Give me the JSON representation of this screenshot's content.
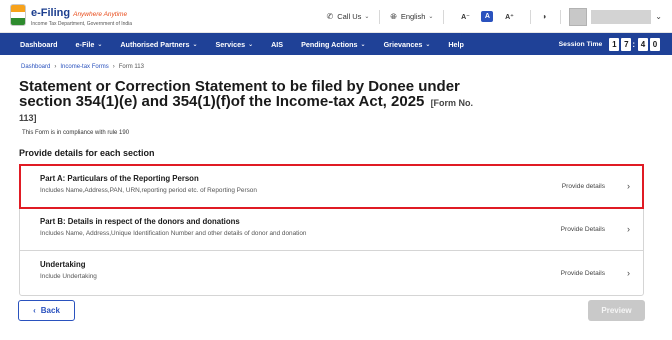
{
  "header": {
    "logo_title": "e-Filing",
    "logo_tagline": "Anywhere Anytime",
    "logo_subtitle": "Income Tax Department, Government of India",
    "call_us": "Call Us",
    "language": "English",
    "font_decrease": "A⁻",
    "font_default": "A",
    "font_increase": "A⁺",
    "icons": [
      "phone-icon",
      "globe-icon",
      "contrast-icon",
      "chevron-down-icon"
    ]
  },
  "nav": {
    "items": [
      {
        "label": "Dashboard",
        "dropdown": false
      },
      {
        "label": "e-File",
        "dropdown": true
      },
      {
        "label": "Authorised Partners",
        "dropdown": true
      },
      {
        "label": "Services",
        "dropdown": true
      },
      {
        "label": "AIS",
        "dropdown": false
      },
      {
        "label": "Pending Actions",
        "dropdown": true
      },
      {
        "label": "Grievances",
        "dropdown": true
      },
      {
        "label": "Help",
        "dropdown": false
      }
    ],
    "session_label": "Session Time",
    "session_digits": [
      "1",
      "7",
      "4",
      "0"
    ],
    "colors": {
      "navbar": "#1f4197"
    }
  },
  "breadcrumb": {
    "items": [
      "Dashboard",
      "Income-tax Forms",
      "Form 113"
    ]
  },
  "page": {
    "title": "Statement or Correction Statement to be filed by Donee under section 354(1)(e) and 354(1)(f)of the Income-tax Act, 2025",
    "form_no": "[Form No. 113]",
    "compliance": "This Form is in compliance with rule 190",
    "section_heading": "Provide details for each section"
  },
  "sections": [
    {
      "title": "Part A: Particulars of the Reporting Person",
      "description": "Includes Name,Address,PAN, URN,reporting period etc. of Reporting Person",
      "action": "Provide details",
      "highlighted": true
    },
    {
      "title": "Part B: Details in respect of the donors and donations",
      "description": "Includes Name, Address,Unique Identification Number and other details of donor and donation",
      "action": "Provide Details",
      "highlighted": false
    },
    {
      "title": "Undertaking",
      "description": "Include Undertaking",
      "action": "Provide Details",
      "highlighted": false
    }
  ],
  "buttons": {
    "back": "Back",
    "preview": "Preview"
  },
  "colors": {
    "accent": "#2a52be",
    "highlight_border": "#e01b24",
    "disabled_button": "#c9c9c9"
  }
}
